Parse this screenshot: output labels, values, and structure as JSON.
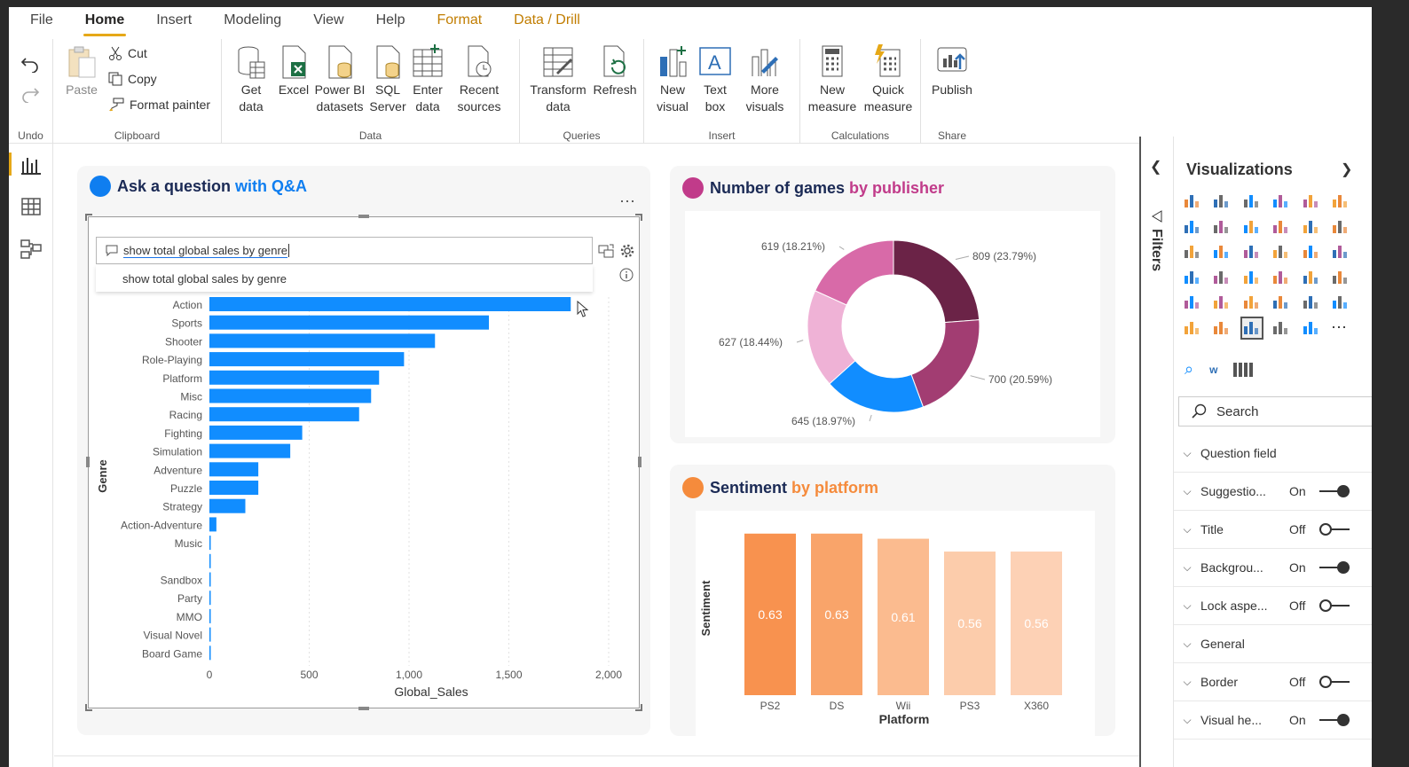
{
  "menu": [
    "File",
    "Home",
    "Insert",
    "Modeling",
    "View",
    "Help",
    "Format",
    "Data / Drill"
  ],
  "ribbon": {
    "undo_group": "Undo",
    "clipboard": {
      "label": "Clipboard",
      "paste": "Paste",
      "cut": "Cut",
      "copy": "Copy",
      "format_painter": "Format painter"
    },
    "data": {
      "label": "Data",
      "get_data": "Get\ndata",
      "excel": "Excel",
      "pbi": "Power BI\ndatasets",
      "sql": "SQL\nServer",
      "enter": "Enter\ndata",
      "recent": "Recent\nsources"
    },
    "queries": {
      "label": "Queries",
      "transform": "Transform\ndata",
      "refresh": "Refresh"
    },
    "insert": {
      "label": "Insert",
      "new_visual": "New\nvisual",
      "text_box": "Text\nbox",
      "more_visuals": "More\nvisuals"
    },
    "calculations": {
      "label": "Calculations",
      "new_measure": "New\nmeasure",
      "quick_measure": "Quick\nmeasure"
    },
    "share": {
      "label": "Share",
      "publish": "Publish"
    }
  },
  "qa_card": {
    "title_part1": "Ask a question",
    "title_part2": "with Q&A",
    "question": "show total global sales by genre",
    "suggestion": "show total global sales by genre",
    "accent": "#0f7ef0"
  },
  "donut_card": {
    "title_part1": "Number of games",
    "title_part2": "by publisher",
    "accent": "#c13b8a"
  },
  "sentiment_card": {
    "title_part1": "Sentiment",
    "title_part2": "by platform",
    "accent": "#f58b3c"
  },
  "chart_data": [
    {
      "type": "bar",
      "orientation": "horizontal",
      "categories": [
        "Action",
        "Sports",
        "Shooter",
        "Role-Playing",
        "Platform",
        "Misc",
        "Racing",
        "Fighting",
        "Simulation",
        "Adventure",
        "Puzzle",
        "Strategy",
        "Action-Adventure",
        "Music",
        "",
        "Sandbox",
        "Party",
        "MMO",
        "Visual Novel",
        "Board Game"
      ],
      "values": [
        1810,
        1400,
        1130,
        975,
        850,
        810,
        750,
        465,
        405,
        245,
        245,
        180,
        35,
        5,
        3,
        3,
        2,
        2,
        1,
        1
      ],
      "xlabel": "Global_Sales",
      "ylabel": "Genre",
      "xlim": [
        0,
        2000
      ],
      "xticks": [
        "0",
        "500",
        "1,000",
        "1,500",
        "2,000"
      ],
      "color": "#118dff",
      "grid": true
    },
    {
      "type": "pie",
      "variant": "donut",
      "slices": [
        {
          "value": 809,
          "label": "809 (23.79%)",
          "color": "#6b2347"
        },
        {
          "value": 700,
          "label": "700 (20.59%)",
          "color": "#a23d72"
        },
        {
          "value": 645,
          "label": "645 (18.97%)",
          "color": "#118dff"
        },
        {
          "value": 627,
          "label": "627 (18.44%)",
          "color": "#efb2d6"
        },
        {
          "value": 619,
          "label": "619 (18.21%)",
          "color": "#d86aa8"
        }
      ]
    },
    {
      "type": "bar",
      "categories": [
        "PS2",
        "DS",
        "Wii",
        "PS3",
        "X360"
      ],
      "values": [
        0.63,
        0.63,
        0.61,
        0.56,
        0.56
      ],
      "labels": [
        "0.63",
        "0.63",
        "0.61",
        "0.56",
        "0.56"
      ],
      "colors": [
        "#f8924f",
        "#f9a46a",
        "#fbbb8f",
        "#fcccab",
        "#fdd1b5"
      ],
      "xlabel": "Platform",
      "ylabel": "Sentiment",
      "ylim": [
        0,
        0.65
      ]
    }
  ],
  "filters_label": "Filters",
  "viz_pane": {
    "title": "Visualizations",
    "search_placeholder": "Search",
    "rows": [
      {
        "label": "Question field",
        "state": "",
        "toggle": ""
      },
      {
        "label": "Suggestio...",
        "state": "On",
        "toggle": "on"
      },
      {
        "label": "Title",
        "state": "Off",
        "toggle": "off"
      },
      {
        "label": "Backgrou...",
        "state": "On",
        "toggle": "on"
      },
      {
        "label": "Lock aspe...",
        "state": "Off",
        "toggle": "off"
      },
      {
        "label": "General",
        "state": "",
        "toggle": ""
      },
      {
        "label": "Border",
        "state": "Off",
        "toggle": "off"
      },
      {
        "label": "Visual he...",
        "state": "On",
        "toggle": "on"
      }
    ]
  }
}
